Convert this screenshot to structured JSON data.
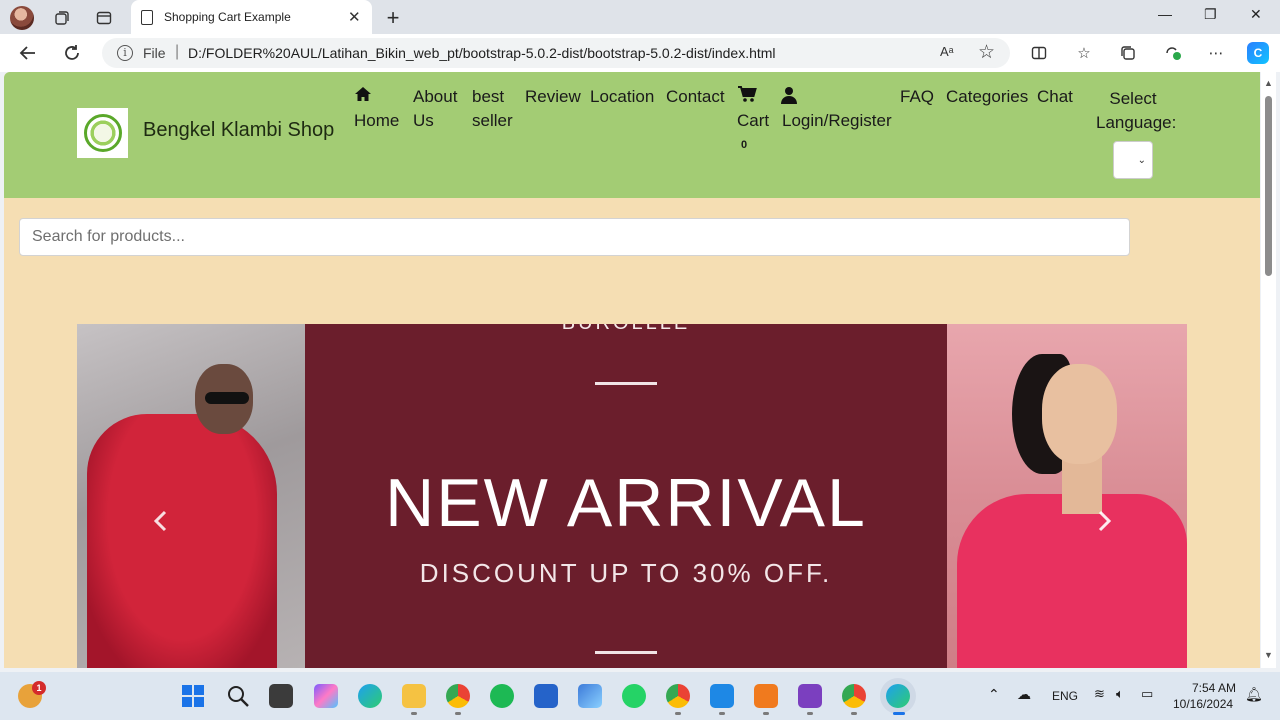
{
  "browser": {
    "tab_title": "Shopping Cart Example",
    "tab_close": "✕",
    "new_tab": "+",
    "address": {
      "scheme_label": "File",
      "separator": "|",
      "url": "D:/FOLDER%20AUL/Latihan_Bikin_web_pt/bootstrap-5.0.2-dist/bootstrap-5.0.2-dist/index.html"
    },
    "read_aloud": "Aᵃ",
    "window": {
      "minimize": "—",
      "restore": "❐",
      "close": "✕"
    }
  },
  "site": {
    "brand": "Bengkel Klambi Shop",
    "nav": {
      "home": "Home",
      "about": [
        "About",
        "Us"
      ],
      "best": [
        "best",
        "seller"
      ],
      "review": "Review",
      "location": "Location",
      "contact": "Contact",
      "cart": "Cart",
      "cart_count": "0",
      "login": "Login/Register",
      "faq": "FAQ",
      "categories": "Categories",
      "chat": "Chat"
    },
    "language": {
      "label_line1": "Select",
      "label_line2": "Language:",
      "selected": ""
    },
    "search": {
      "placeholder": "Search for products..."
    },
    "carousel": {
      "brand_text": "BUROLLLE",
      "headline": "NEW ARRIVAL",
      "subline": "DISCOUNT UP TO 30% OFF.",
      "prev": "‹",
      "next": "›"
    }
  },
  "taskbar": {
    "notification_badge": "1",
    "language": "ENG",
    "time": "7:54 AM",
    "date": "10/16/2024"
  },
  "colors": {
    "navbar_bg": "#a3cc74",
    "page_bg": "#f5deb3",
    "banner_bg": "#6b1e2c"
  }
}
